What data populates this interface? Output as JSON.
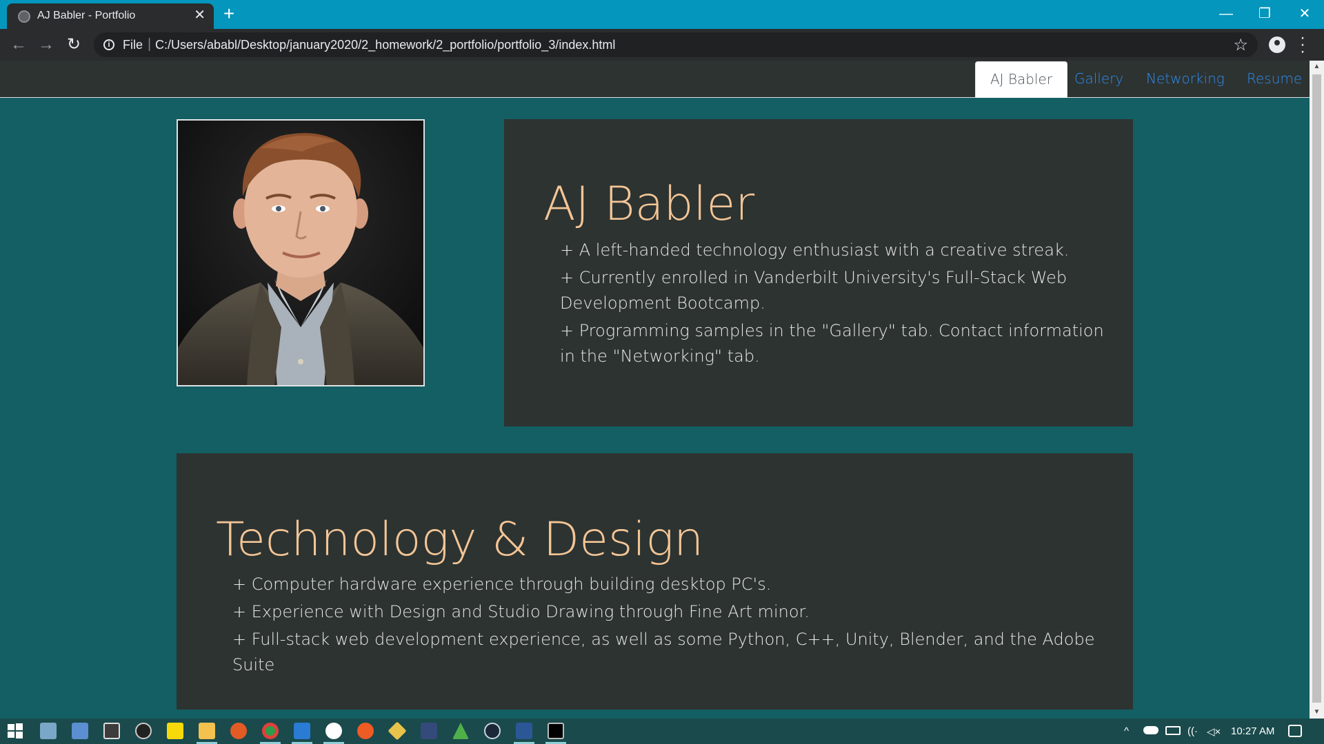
{
  "browser": {
    "tab_title": "AJ Babler - Portfolio",
    "tab_close": "✕",
    "new_tab": "+",
    "scheme_label": "File",
    "url": "C:/Users/ababl/Desktop/january2020/2_homework/2_portfolio/portfolio_3/index.html",
    "window_controls": {
      "minimize": "—",
      "restore": "❐",
      "close": "✕"
    },
    "icons": [
      "back-arrow-icon",
      "forward-arrow-icon",
      "reload-icon",
      "info-icon",
      "star-icon",
      "profile-icon",
      "menu-dots-icon"
    ]
  },
  "site": {
    "nav": [
      {
        "label": "AJ Babler",
        "active": true
      },
      {
        "label": "Gallery",
        "active": false
      },
      {
        "label": "Networking",
        "active": false
      },
      {
        "label": "Resume",
        "active": false
      }
    ],
    "about": {
      "title": "AJ Babler",
      "items": [
        "+ A left-handed technology enthusiast with a creative streak.",
        "+ Currently enrolled in Vanderbilt University's Full-Stack Web Development Bootcamp.",
        "+ Programming samples in the \"Gallery\" tab. Contact information in the \"Networking\" tab."
      ]
    },
    "skills": {
      "title": "Technology & Design",
      "items": [
        "+ Computer hardware experience through building desktop PC's.",
        "+ Experience with Design and Studio Drawing through Fine Art minor.",
        "+ Full-stack web development experience, as well as some Python, C++, Unity, Blender, and the Adobe Suite"
      ]
    },
    "colors": {
      "page_bg": "#135f63",
      "card_bg": "#2d3331",
      "title": "#f3c596",
      "link": "#2e8cf0"
    }
  },
  "taskbar": {
    "clock": "10:27 AM",
    "apps": [
      "windows-start",
      "people",
      "task-manager",
      "calculator",
      "unity",
      "sticky-notes",
      "file-explorer",
      "firefox",
      "chrome",
      "vscode",
      "slack",
      "postman",
      "git",
      "ssms",
      "android-studio",
      "steam",
      "word",
      "terminal"
    ]
  }
}
